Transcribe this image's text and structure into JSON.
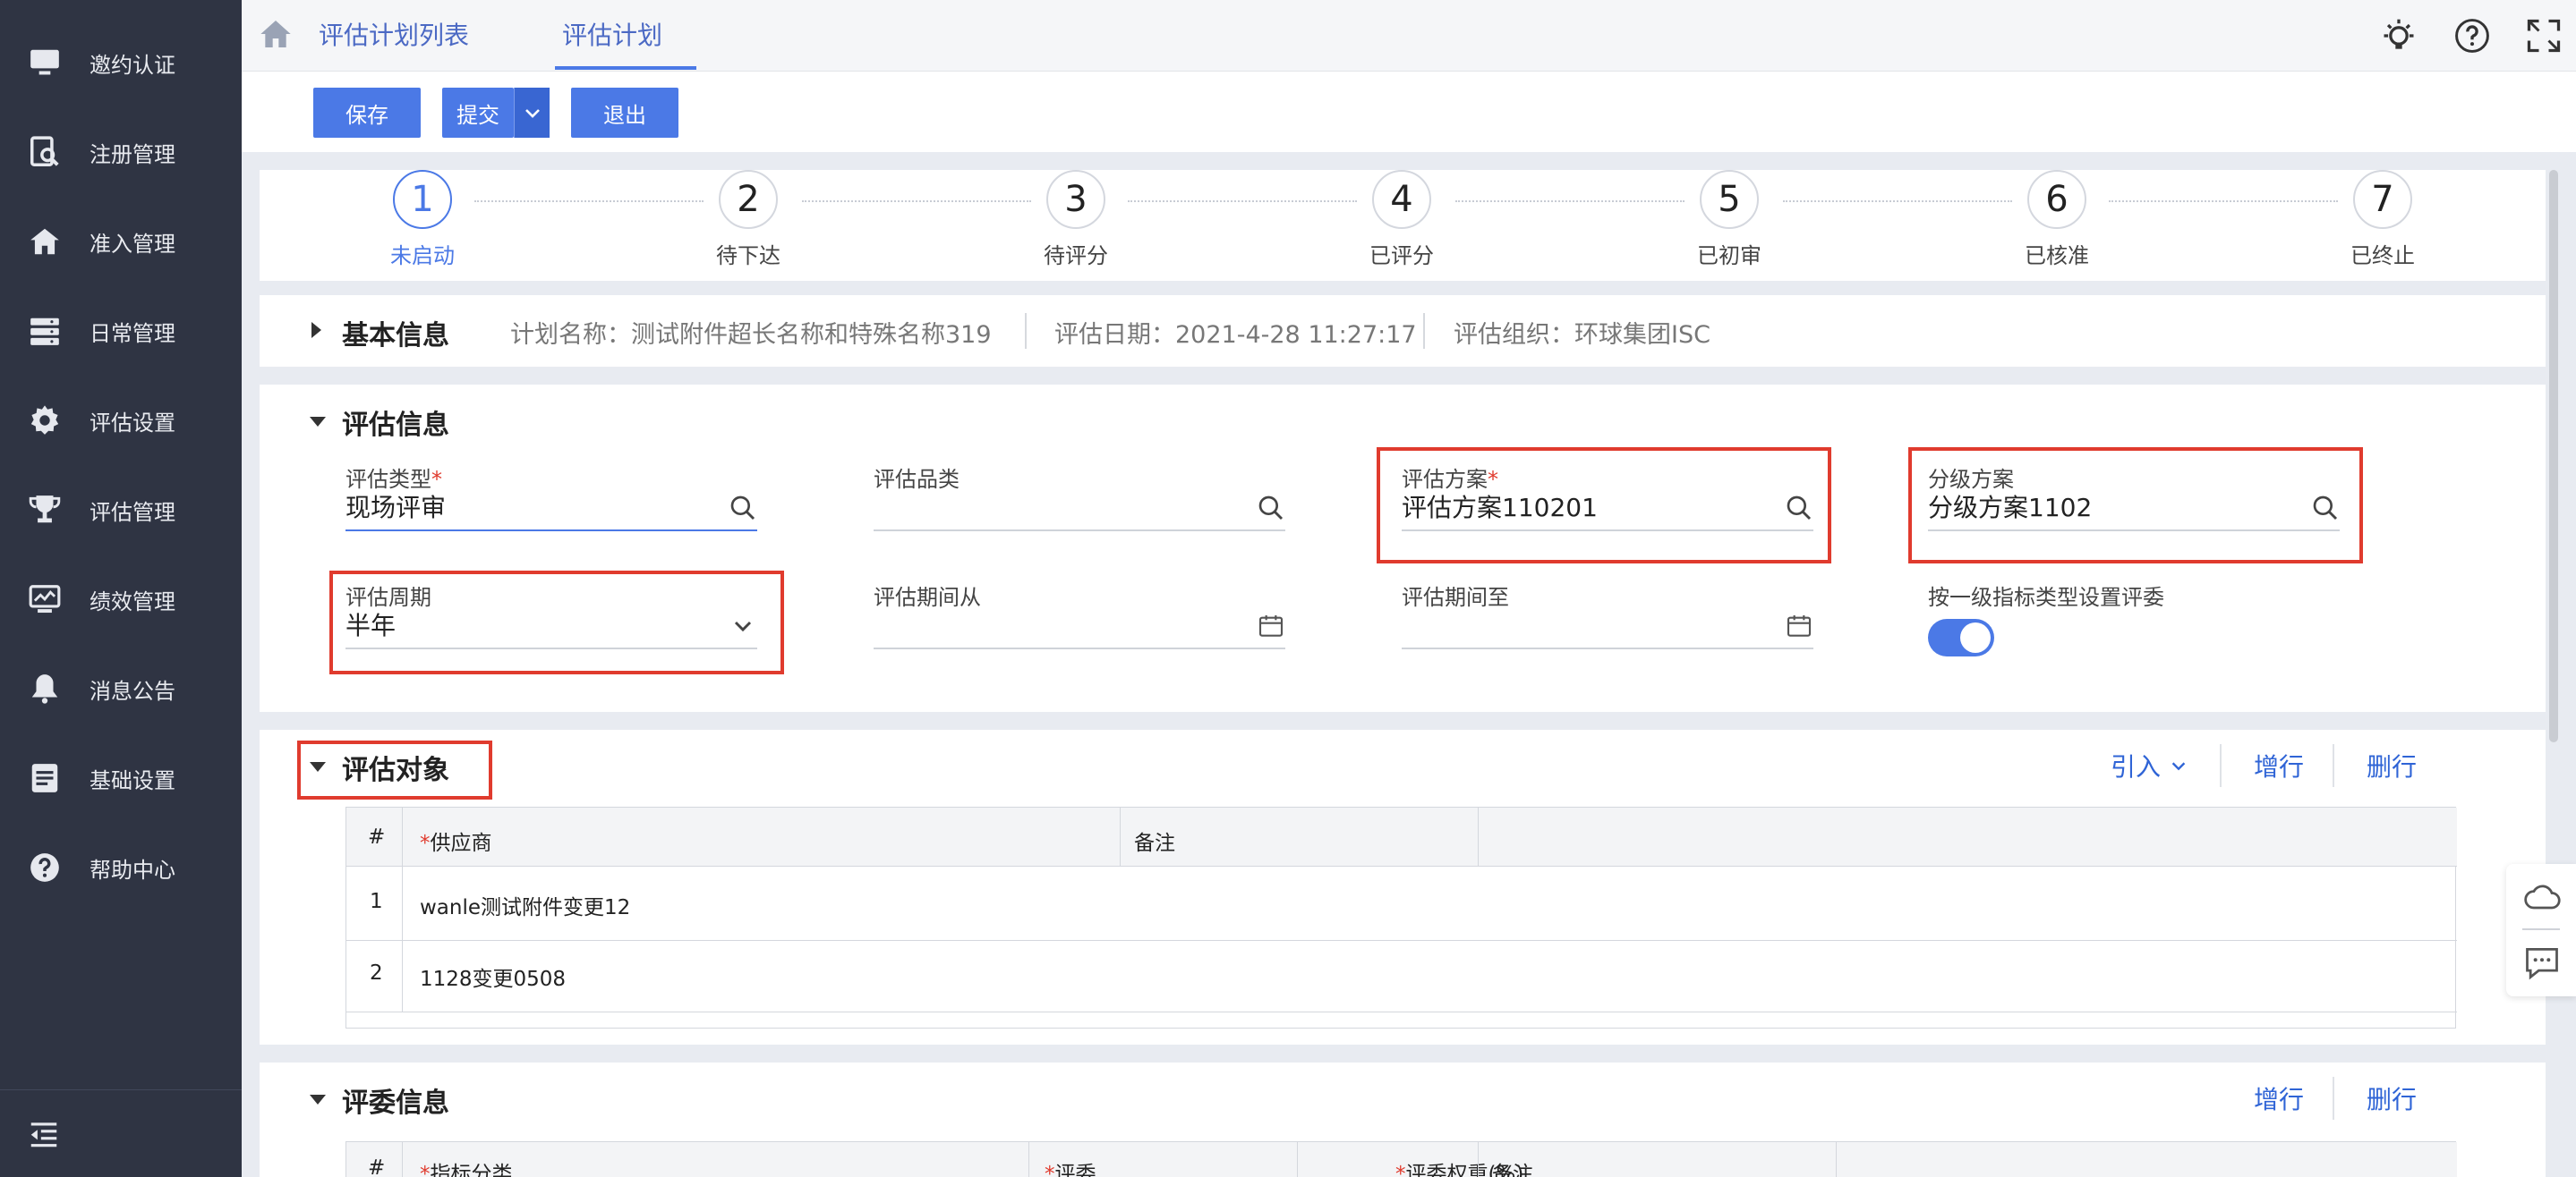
{
  "sidebar": {
    "items": [
      {
        "label": "邀约认证",
        "icon": "monitor-icon"
      },
      {
        "label": "注册管理",
        "icon": "search-doc-icon"
      },
      {
        "label": "准入管理",
        "icon": "home-icon"
      },
      {
        "label": "日常管理",
        "icon": "server-icon"
      },
      {
        "label": "评估设置",
        "icon": "gear-icon"
      },
      {
        "label": "评估管理",
        "icon": "trophy-icon"
      },
      {
        "label": "绩效管理",
        "icon": "chart-monitor-icon"
      },
      {
        "label": "消息公告",
        "icon": "bell-icon"
      },
      {
        "label": "基础设置",
        "icon": "document-icon"
      },
      {
        "label": "帮助中心",
        "icon": "question-icon"
      }
    ]
  },
  "tabs": [
    {
      "label": "评估计划列表",
      "active": false
    },
    {
      "label": "评估计划",
      "active": true
    }
  ],
  "toolbar": {
    "save_label": "保存",
    "submit_label": "提交",
    "exit_label": "退出"
  },
  "steps": [
    {
      "num": "1",
      "label": "未启动",
      "active": true
    },
    {
      "num": "2",
      "label": "待下达",
      "active": false
    },
    {
      "num": "3",
      "label": "待评分",
      "active": false
    },
    {
      "num": "4",
      "label": "已评分",
      "active": false
    },
    {
      "num": "5",
      "label": "已初审",
      "active": false
    },
    {
      "num": "6",
      "label": "已核准",
      "active": false
    },
    {
      "num": "7",
      "label": "已终止",
      "active": false
    }
  ],
  "basic_info": {
    "title": "基本信息",
    "plan_name": "计划名称：测试附件超长名称和特殊名称319",
    "eval_date": "评估日期：2021-4-28 11:27:17",
    "eval_org": "评估组织：环球集团ISC"
  },
  "eval_info": {
    "title": "评估信息",
    "fields": {
      "eval_type": {
        "label": "评估类型",
        "value": "现场评审",
        "required": true
      },
      "category": {
        "label": "评估品类",
        "value": ""
      },
      "scheme": {
        "label": "评估方案",
        "value": "评估方案110201",
        "required": true
      },
      "grading": {
        "label": "分级方案",
        "value": "分级方案1102"
      },
      "cycle": {
        "label": "评估周期",
        "value": "半年"
      },
      "period_from": {
        "label": "评估期间从",
        "value": ""
      },
      "period_to": {
        "label": "评估期间至",
        "value": ""
      },
      "by_indicator": {
        "label": "按一级指标类型设置评委",
        "on": true
      }
    }
  },
  "eval_target": {
    "title": "评估对象",
    "import_label": "引入",
    "add_label": "增行",
    "delete_label": "删行",
    "columns": {
      "num": "#",
      "supplier": "供应商",
      "remark": "备注"
    },
    "rows": [
      {
        "num": "1",
        "supplier": "wanle测试附件变更12",
        "remark": ""
      },
      {
        "num": "2",
        "supplier": "1128变更0508",
        "remark": ""
      }
    ]
  },
  "judges": {
    "title": "评委信息",
    "add_label": "增行",
    "delete_label": "删行",
    "columns": {
      "num": "#",
      "category": "指标分类",
      "judge": "评委",
      "weight": "评委权重(%)",
      "remark": "备注"
    }
  },
  "colors": {
    "accent": "#4b79e6",
    "highlight": "#e03b2e",
    "sidebar": "#2f3443"
  }
}
